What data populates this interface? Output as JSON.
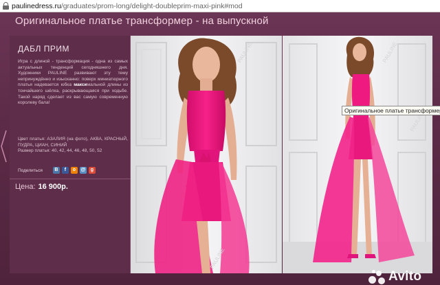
{
  "browser": {
    "url_host": "paulinedress.ru",
    "url_path": "/graduates/prom-long/delight-doubleprim-maxi-pink#mod"
  },
  "site": {
    "title": "Оригинальное платье трансформер - на выпускной"
  },
  "product": {
    "name": "ДАБЛ ПРИМ",
    "description_before": "Игра с длиной - трансформация - одна из самых актуальных тенденций сегодняшнего дня. Художники PAULINE развивают эту тему непринуждённо и изысканно: поверх миниатюрного платья надевается юбка ",
    "description_bold": "макси",
    "description_after": "мальной длины из тончайшего шёлка, раскрывающаяся при ходьбе. Такой наряд сделает из вас самую современную королеву бала!",
    "colors": "Цвет платья: АЗАЛИЯ (на фото), АКВА, КРАСНЫЙ, ПУДРА, ЦИАН, СИНИЙ",
    "sizes": "Размер платья: 40, 42, 44, 46, 48, 50, 52",
    "share_label": "Поделиться",
    "price_label": "Цена:",
    "price_value": "16 900р."
  },
  "social": [
    {
      "name": "vk",
      "glyph": "B",
      "color": "#4a76a8"
    },
    {
      "name": "facebook",
      "glyph": "f",
      "color": "#3b5998"
    },
    {
      "name": "odnoklassniki",
      "glyph": "о",
      "color": "#ee8208"
    },
    {
      "name": "mail",
      "glyph": "@",
      "color": "#5a8fc1"
    },
    {
      "name": "google",
      "glyph": "g",
      "color": "#dd4b39"
    }
  ],
  "tooltip": "Оригинальное платье трансформер - на выпускной",
  "watermark": "PAULINE",
  "avito_logo": "Avito",
  "colors": {
    "dress_pink": "#f0187f",
    "panel_bg": "#5e2d49",
    "site_bg": "#5a2a44"
  }
}
